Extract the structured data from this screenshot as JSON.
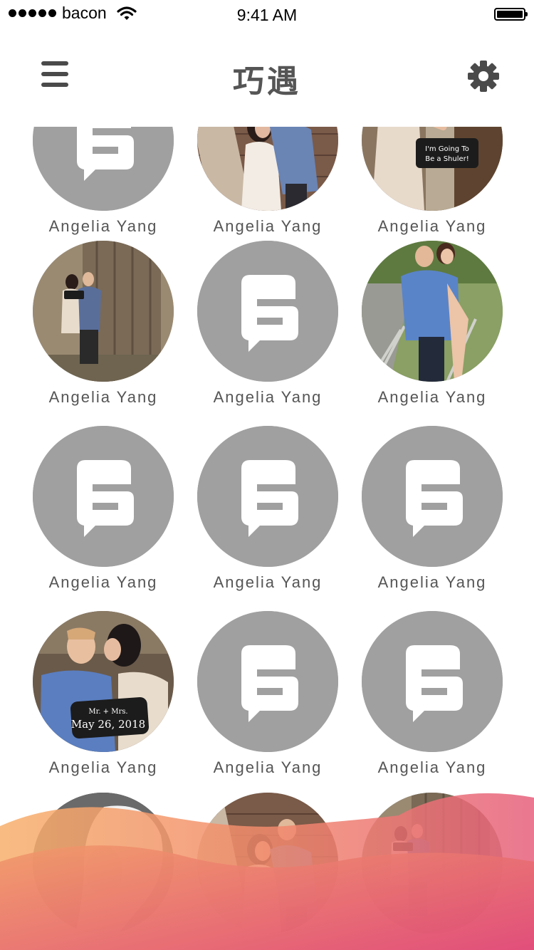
{
  "status_bar": {
    "carrier": "bacon",
    "time": "9:41 AM"
  },
  "nav": {
    "title": "巧遇",
    "menu_icon": "hamburger-menu-icon",
    "settings_icon": "gear-icon"
  },
  "colors": {
    "placeholder_avatar": "#a0a0a0",
    "text": "#555555",
    "wave_orange": "#f4a86c",
    "wave_pink": "#e4507a"
  },
  "users": [
    {
      "name": "Angelia Yang",
      "photo": "placeholder"
    },
    {
      "name": "Angelia Yang",
      "photo": "couple-brick-wall"
    },
    {
      "name": "Angelia Yang",
      "photo": "woman-holding-sign"
    },
    {
      "name": "Angelia Yang",
      "photo": "couple-barn-door"
    },
    {
      "name": "Angelia Yang",
      "photo": "placeholder"
    },
    {
      "name": "Angelia Yang",
      "photo": "piggyback-couple"
    },
    {
      "name": "Angelia Yang",
      "photo": "placeholder"
    },
    {
      "name": "Angelia Yang",
      "photo": "placeholder"
    },
    {
      "name": "Angelia Yang",
      "photo": "placeholder"
    },
    {
      "name": "Angelia Yang",
      "photo": "couple-kiss-sign"
    },
    {
      "name": "Angelia Yang",
      "photo": "placeholder"
    },
    {
      "name": "Angelia Yang",
      "photo": "placeholder"
    },
    {
      "name": "",
      "photo": "bw-portrait"
    },
    {
      "name": "",
      "photo": "couple-brick-wall"
    },
    {
      "name": "",
      "photo": "couple-barn-door"
    }
  ]
}
